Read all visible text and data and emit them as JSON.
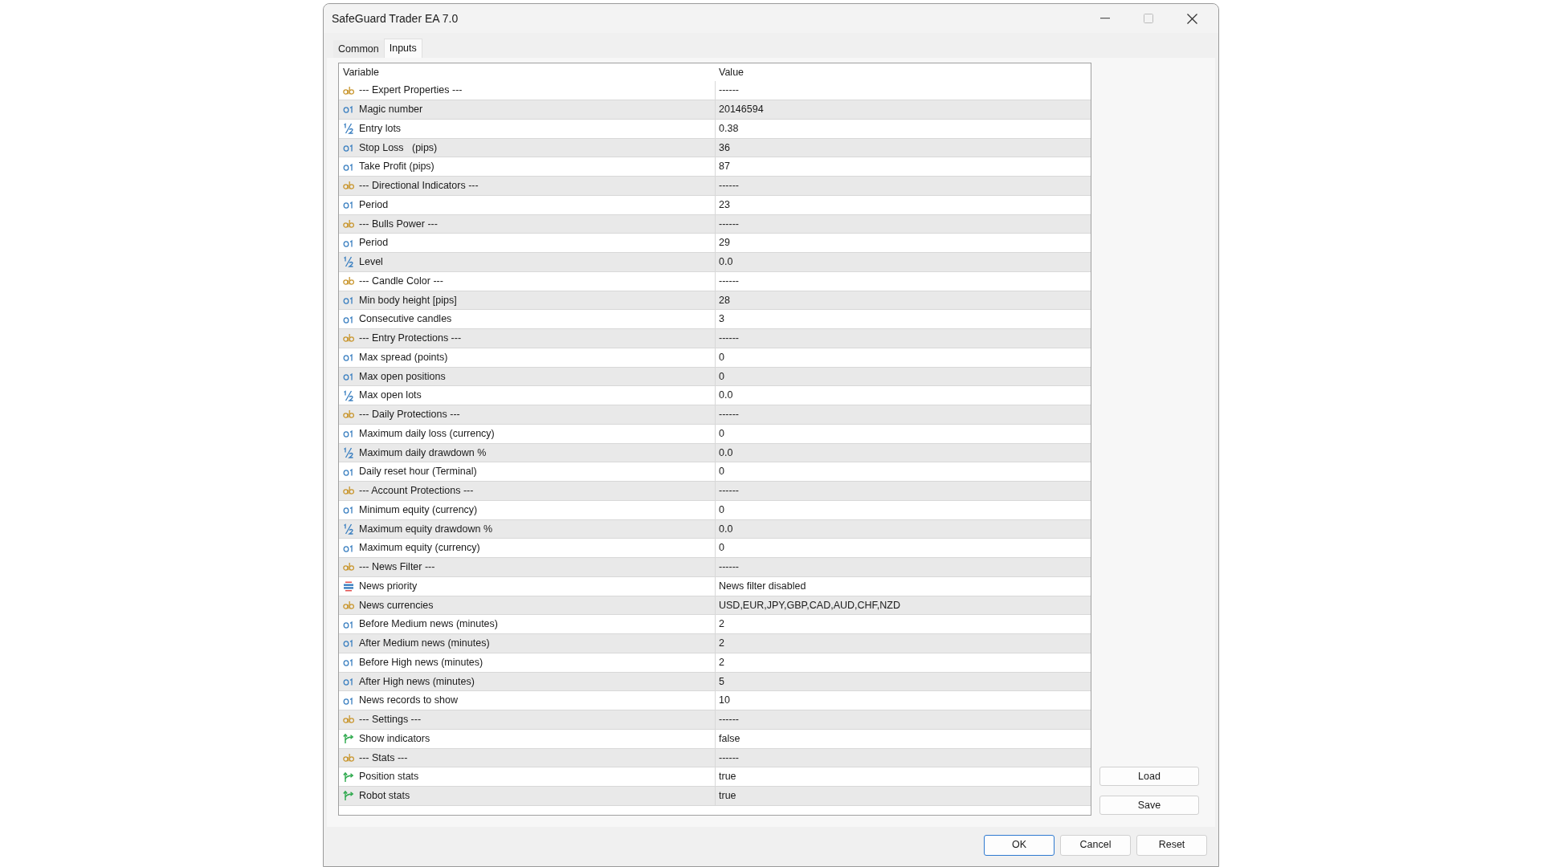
{
  "window": {
    "title": "SafeGuard Trader EA 7.0"
  },
  "tabs": [
    {
      "label": "Common",
      "selected": false
    },
    {
      "label": "Inputs",
      "selected": true
    }
  ],
  "table": {
    "columns": [
      "Variable",
      "Value"
    ],
    "rows": [
      {
        "kind": "string",
        "variable": "--- Expert Properties ---",
        "value": "------"
      },
      {
        "kind": "int",
        "variable": "Magic number",
        "value": "20146594"
      },
      {
        "kind": "double",
        "variable": "Entry lots",
        "value": "0.38"
      },
      {
        "kind": "int",
        "variable": "Stop Loss   (pips)",
        "value": "36"
      },
      {
        "kind": "int",
        "variable": "Take Profit (pips)",
        "value": "87"
      },
      {
        "kind": "string",
        "variable": "--- Directional Indicators ---",
        "value": "------"
      },
      {
        "kind": "int",
        "variable": "Period",
        "value": "23"
      },
      {
        "kind": "string",
        "variable": "--- Bulls Power ---",
        "value": "------"
      },
      {
        "kind": "int",
        "variable": "Period",
        "value": "29"
      },
      {
        "kind": "double",
        "variable": "Level",
        "value": "0.0"
      },
      {
        "kind": "string",
        "variable": "--- Candle Color ---",
        "value": "------"
      },
      {
        "kind": "int",
        "variable": "Min body height [pips]",
        "value": "28"
      },
      {
        "kind": "int",
        "variable": "Consecutive candles",
        "value": "3"
      },
      {
        "kind": "string",
        "variable": "--- Entry Protections ---",
        "value": "------"
      },
      {
        "kind": "int",
        "variable": "Max spread (points)",
        "value": "0"
      },
      {
        "kind": "int",
        "variable": "Max open positions",
        "value": "0"
      },
      {
        "kind": "double",
        "variable": "Max open lots",
        "value": "0.0"
      },
      {
        "kind": "string",
        "variable": "--- Daily Protections ---",
        "value": "------"
      },
      {
        "kind": "int",
        "variable": "Maximum daily loss (currency)",
        "value": "0"
      },
      {
        "kind": "double",
        "variable": "Maximum daily drawdown %",
        "value": "0.0"
      },
      {
        "kind": "int",
        "variable": "Daily reset hour (Terminal)",
        "value": "0"
      },
      {
        "kind": "string",
        "variable": "--- Account Protections ---",
        "value": "------"
      },
      {
        "kind": "int",
        "variable": "Minimum equity (currency)",
        "value": "0"
      },
      {
        "kind": "double",
        "variable": "Maximum equity drawdown %",
        "value": "0.0"
      },
      {
        "kind": "int",
        "variable": "Maximum equity (currency)",
        "value": "0"
      },
      {
        "kind": "string",
        "variable": "--- News Filter ---",
        "value": "------"
      },
      {
        "kind": "enum",
        "variable": "News priority",
        "value": "News filter disabled"
      },
      {
        "kind": "string",
        "variable": "News currencies",
        "value": "USD,EUR,JPY,GBP,CAD,AUD,CHF,NZD"
      },
      {
        "kind": "int",
        "variable": "Before Medium news (minutes)",
        "value": "2"
      },
      {
        "kind": "int",
        "variable": "After Medium news (minutes)",
        "value": "2"
      },
      {
        "kind": "int",
        "variable": "Before High news (minutes)",
        "value": "2"
      },
      {
        "kind": "int",
        "variable": "After High news (minutes)",
        "value": "5"
      },
      {
        "kind": "int",
        "variable": "News records to show",
        "value": "10"
      },
      {
        "kind": "string",
        "variable": "--- Settings ---",
        "value": "------"
      },
      {
        "kind": "bool",
        "variable": "Show indicators",
        "value": "false"
      },
      {
        "kind": "string",
        "variable": "--- Stats ---",
        "value": "------"
      },
      {
        "kind": "bool",
        "variable": "Position stats",
        "value": "true"
      },
      {
        "kind": "bool",
        "variable": "Robot stats",
        "value": "true"
      }
    ]
  },
  "side_buttons": [
    "Load",
    "Save"
  ],
  "buttons": [
    {
      "label": "OK",
      "default": true
    },
    {
      "label": "Cancel",
      "default": false
    },
    {
      "label": "Reset",
      "default": false
    }
  ]
}
